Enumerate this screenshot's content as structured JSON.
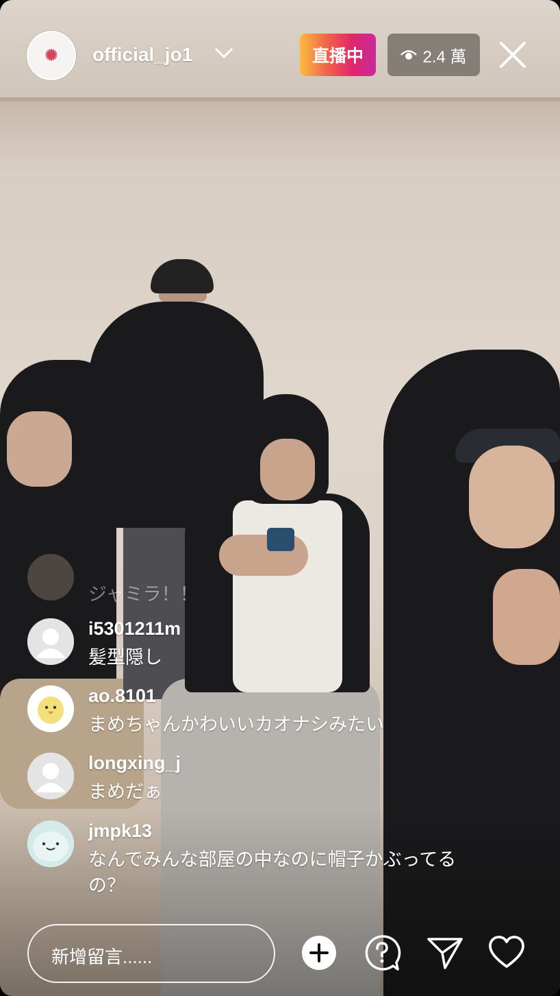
{
  "header": {
    "username": "official_jo1",
    "live_label": "直播中",
    "viewer_count": "2.4 萬"
  },
  "comments": [
    {
      "user": "",
      "text": "ジャミラ！！",
      "avatar": "user-avatar",
      "faded": true
    },
    {
      "user": "i5301211m",
      "text": "髪型隠し",
      "avatar": "default-avatar"
    },
    {
      "user": "ao.8101",
      "text": "まめちゃんかわいいカオナシみたい",
      "avatar": "chick-avatar"
    },
    {
      "user": "longxing_j",
      "text": "まめだぁ",
      "avatar": "default-avatar"
    },
    {
      "user": "jmpk13",
      "text": "なんでみんな部屋の中なのに帽子かぶってるの？",
      "avatar": "seal-avatar"
    }
  ],
  "bottom_bar": {
    "comment_placeholder": "新增留言......",
    "icons": [
      "add-icon",
      "question-icon",
      "send-icon",
      "heart-icon"
    ]
  },
  "colors": {
    "live_gradient": [
      "#fdba3f",
      "#e0256a",
      "#c92a9e"
    ],
    "text": "#ffffff"
  }
}
